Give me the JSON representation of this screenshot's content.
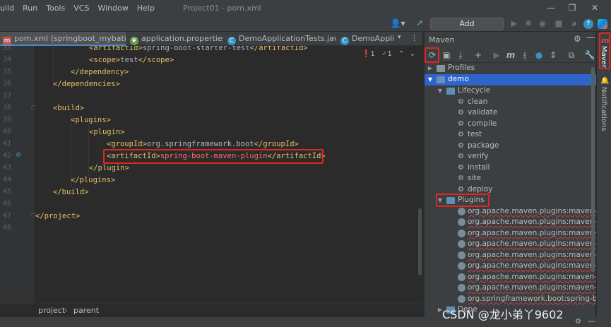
{
  "menubar": {
    "items": [
      "uild",
      "Run",
      "Tools",
      "VCS",
      "Window",
      "Help"
    ],
    "project_title": "Project01 - pom.xml"
  },
  "toolbar": {
    "run_config_label": "Add Configuration..."
  },
  "tabs": [
    {
      "label": "pom.xml (springboot_mybatis)",
      "icon": "maven-m-icon",
      "active": true
    },
    {
      "label": "application.properties",
      "icon": "spring-leaf-icon",
      "active": false
    },
    {
      "label": "DemoApplicationTests.java",
      "icon": "java-class-icon",
      "active": false
    },
    {
      "label": "DemoApplic",
      "icon": "java-class-icon",
      "active": false
    }
  ],
  "editor": {
    "inspections": {
      "errors": "1",
      "warnings": "1"
    },
    "lines": [
      {
        "n": "35",
        "text": "<artifactId>spring-boot-starter-test</artifactId>"
      },
      {
        "n": "34",
        "text": "<scope>test</scope>"
      },
      {
        "n": "35",
        "text": "</dependency>"
      },
      {
        "n": "36",
        "text": "</dependencies>"
      },
      {
        "n": "37",
        "text": ""
      },
      {
        "n": "38",
        "text": "<build>"
      },
      {
        "n": "39",
        "text": "<plugins>"
      },
      {
        "n": "40",
        "text": "<plugin>"
      },
      {
        "n": "41",
        "text": "<groupId>org.springframework.boot</groupId>"
      },
      {
        "n": "42",
        "text": "<artifactId>spring-boot-maven-plugin</artifactId>"
      },
      {
        "n": "43",
        "text": "</plugin>"
      },
      {
        "n": "44",
        "text": "</plugins>"
      },
      {
        "n": "45",
        "text": "</build>"
      },
      {
        "n": "46",
        "text": ""
      },
      {
        "n": "47",
        "text": "</project>"
      },
      {
        "n": "48",
        "text": ""
      }
    ],
    "line41": {
      "open": "<groupId>",
      "value": "org.springframework.boot",
      "close": "</groupId>"
    },
    "line42": {
      "open": "<artifactId>",
      "value": "spring-boot-maven-plugin",
      "close": "</artifactId>"
    },
    "line34": {
      "open": "<scope>",
      "value": "test",
      "close": "</scope>"
    }
  },
  "breadcrumb": [
    "project",
    "parent"
  ],
  "maven": {
    "title": "Maven",
    "tree": {
      "profiles": "Profiles",
      "project": "demo",
      "lifecycle": "Lifecycle",
      "phases": [
        "clean",
        "validate",
        "compile",
        "test",
        "package",
        "verify",
        "install",
        "site",
        "deploy"
      ],
      "plugins": "Plugins",
      "plugin_items": [
        "org.apache.maven.plugins:maven-clean-plu",
        "org.apache.maven.plugins:maven-compile",
        "org.apache.maven.plugins:maven-deploy-",
        "org.apache.maven.plugins:maven-install-p",
        "org.apache.maven.plugins:maven-jar-plug",
        "org.apache.maven.plugins:maven-resourc",
        "org.apache.maven.plugins:maven-site-plu",
        "org.apache.maven.plugins:maven-surefire",
        "org.springframework.boot:spring-boot-m"
      ],
      "dependencies_partial": "Depe"
    }
  },
  "right_strip": {
    "maven_label": "Maven",
    "notifications_label": "Notifications"
  },
  "watermark": "CSDN @龙小弟丫9602"
}
